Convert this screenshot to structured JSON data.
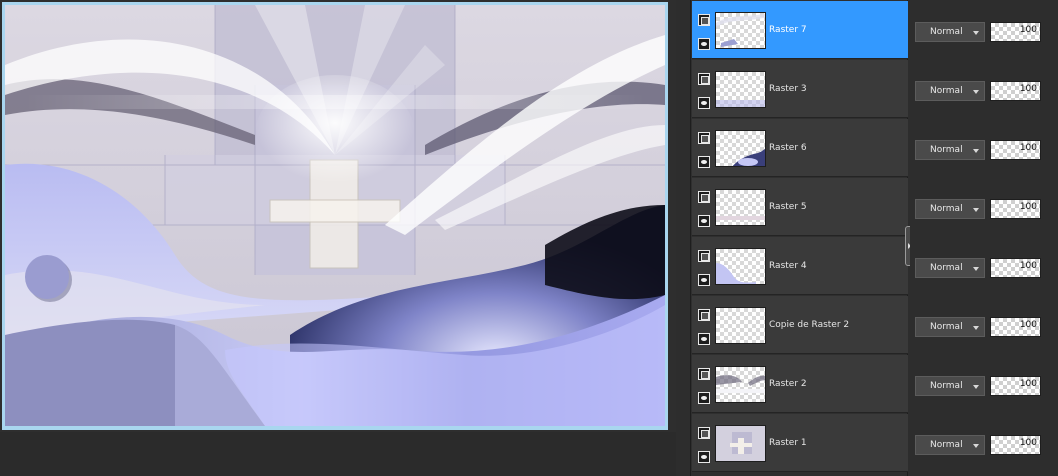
{
  "layers": [
    {
      "name": "Raster 7",
      "selected": true,
      "blend_mode": "Normal",
      "opacity": "100"
    },
    {
      "name": "Raster 3",
      "selected": false,
      "blend_mode": "Normal",
      "opacity": "100"
    },
    {
      "name": "Raster 6",
      "selected": false,
      "blend_mode": "Normal",
      "opacity": "100"
    },
    {
      "name": "Raster 5",
      "selected": false,
      "blend_mode": "Normal",
      "opacity": "100"
    },
    {
      "name": "Raster 4",
      "selected": false,
      "blend_mode": "Normal",
      "opacity": "100"
    },
    {
      "name": "Copie de Raster 2",
      "selected": false,
      "blend_mode": "Normal",
      "opacity": "100"
    },
    {
      "name": "Raster 2",
      "selected": false,
      "blend_mode": "Normal",
      "opacity": "100"
    },
    {
      "name": "Raster 1",
      "selected": false,
      "blend_mode": "Normal",
      "opacity": "100"
    }
  ],
  "icons": {
    "lock": "lock-icon",
    "visibility": "eye-icon",
    "dropdown": "chevron-down-icon",
    "splitter": "chevron-right-icon"
  },
  "colors": {
    "selection": "#3399ff",
    "panel": "#3a3a3a",
    "background": "#2d2d2d",
    "canvas_border": "#a9d6ef"
  }
}
